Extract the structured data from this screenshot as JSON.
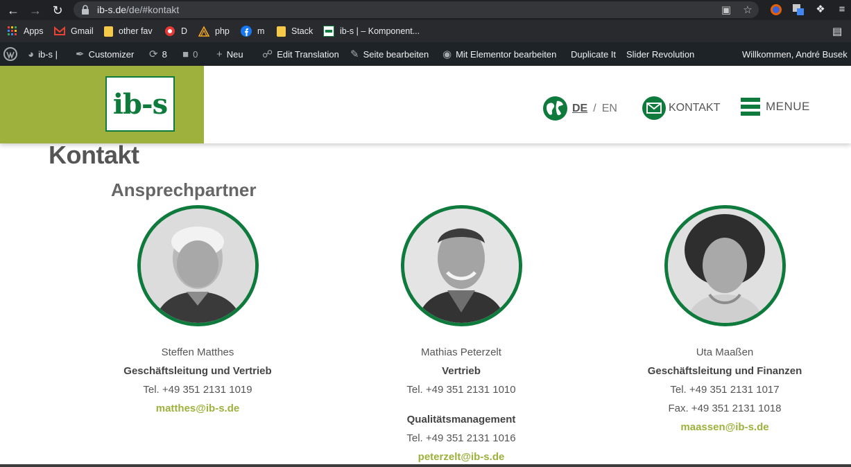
{
  "browser": {
    "url_host": "ib-s.de",
    "url_path": "/de/#kontakt",
    "bookmarks": [
      {
        "label": "Apps",
        "icon": "apps-grid-icon"
      },
      {
        "label": "Gmail",
        "icon": "gmail-icon"
      },
      {
        "label": "other fav",
        "icon": "folder-icon"
      },
      {
        "label": "D",
        "icon": "d-icon"
      },
      {
        "label": "php",
        "icon": "php-icon"
      },
      {
        "label": "m",
        "icon": "facebook-icon"
      },
      {
        "label": "Stack",
        "icon": "folder-icon"
      },
      {
        "label": "ib-s | – Komponent...",
        "icon": "ibs-favicon-icon"
      }
    ]
  },
  "adminbar": {
    "site": "ib-s |",
    "customizer": "Customizer",
    "updates": "8",
    "comments": "0",
    "new": "Neu",
    "edit_translation": "Edit Translation",
    "edit_page": "Seite bearbeiten",
    "elementor": "Mit Elementor bearbeiten",
    "duplicate": "Duplicate It",
    "slider": "Slider Revolution",
    "welcome": "Willkommen, André Busek"
  },
  "header": {
    "logo": "ib-s",
    "lang_active": "DE",
    "lang_sep": "/",
    "lang_other": "EN",
    "contact": "KONTAKT",
    "menu": "MENUE"
  },
  "content": {
    "title": "Kontakt",
    "section": "Ansprechpartner",
    "people": [
      {
        "name": "Steffen Matthes",
        "role": "Geschäftsleitung und Vertrieb",
        "tel": "Tel. +49 351 2131 1019",
        "email": "matthes@ib-s.de"
      },
      {
        "name": "Mathias Peterzelt",
        "role": "Vertrieb",
        "tel": "Tel. +49 351 2131 1010",
        "role2": "Qualitätsmanagement",
        "tel2": "Tel. +49 351 2131 1016",
        "email": "peterzelt@ib-s.de"
      },
      {
        "name": "Uta Maaßen",
        "role": "Geschäftsleitung und Finanzen",
        "tel": "Tel. +49 351 2131 1017",
        "fax": "Fax. +49 351 2131 1018",
        "email": "maassen@ib-s.de"
      }
    ]
  },
  "colors": {
    "brand_green": "#0e7a3c",
    "lime": "#9db13c",
    "adminbar": "#1d2327"
  }
}
